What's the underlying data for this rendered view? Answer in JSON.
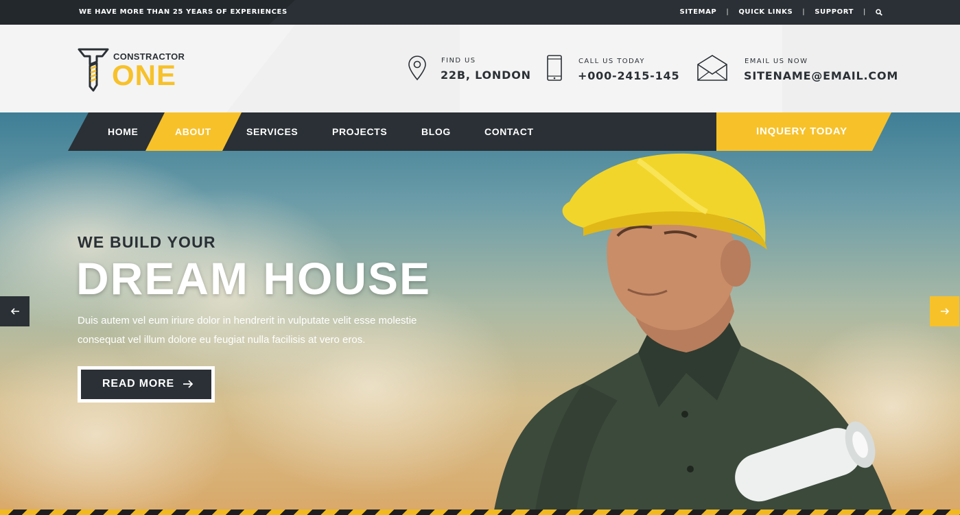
{
  "topbar": {
    "tagline": "WE HAVE MORE THAN 25 YEARS OF EXPERIENCES",
    "links": [
      "SITEMAP",
      "QUICK LINKS",
      "SUPPORT"
    ],
    "separator": "|"
  },
  "logo": {
    "small": "CONSTRACTOR",
    "big": "ONE"
  },
  "contact": {
    "location": {
      "label": "FIND US",
      "value": "22B, LONDON",
      "icon": "map-pin-icon"
    },
    "phone": {
      "label": "CALL US TODAY",
      "value": "+000-2415-145",
      "icon": "phone-icon"
    },
    "email": {
      "label": "EMAIL US NOW",
      "value": "SITENAME@EMAIL.COM",
      "icon": "envelope-icon"
    }
  },
  "nav": {
    "items": [
      "HOME",
      "ABOUT",
      "SERVICES",
      "PROJECTS",
      "BLOG",
      "CONTACT"
    ],
    "active": "ABOUT",
    "cta": "INQUERY TODAY"
  },
  "hero": {
    "subtitle": "WE BUILD YOUR",
    "title": "DREAM HOUSE",
    "desc_line1": "Duis autem vel eum iriure dolor in hendrerit in vulputate velit esse molestie",
    "desc_line2": "consequat  vel illum dolore eu feugiat nulla facilisis at vero eros.",
    "button": "READ MORE"
  },
  "colors": {
    "accent": "#f7c12a",
    "dark": "#2a3035"
  }
}
